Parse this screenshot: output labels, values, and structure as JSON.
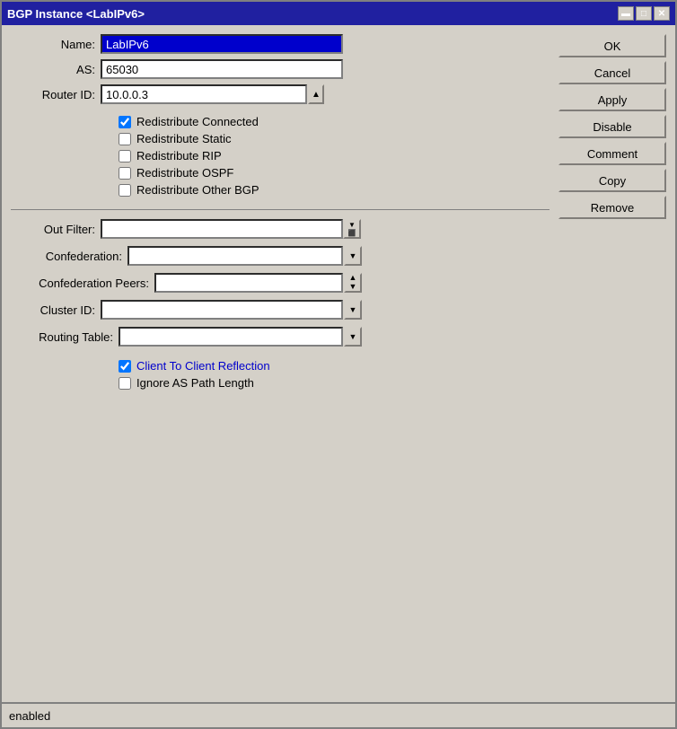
{
  "window": {
    "title": "BGP Instance <LabIPv6>",
    "min_label": "▬",
    "max_label": "□",
    "close_label": "✕"
  },
  "form": {
    "name_label": "Name:",
    "name_value": "LabIPv6",
    "as_label": "AS:",
    "as_value": "65030",
    "router_id_label": "Router ID:",
    "router_id_value": "10.0.0.3",
    "spin_up": "▲",
    "checkboxes": [
      {
        "label": "Redistribute Connected",
        "checked": true
      },
      {
        "label": "Redistribute Static",
        "checked": false
      },
      {
        "label": "Redistribute RIP",
        "checked": false
      },
      {
        "label": "Redistribute OSPF",
        "checked": false
      },
      {
        "label": "Redistribute Other BGP",
        "checked": false
      }
    ],
    "out_filter_label": "Out Filter:",
    "out_filter_value": "",
    "confederation_label": "Confederation:",
    "confederation_value": "",
    "confederation_peers_label": "Confederation Peers:",
    "confederation_peers_value": "",
    "cluster_id_label": "Cluster ID:",
    "cluster_id_value": "",
    "routing_table_label": "Routing Table:",
    "routing_table_value": "",
    "bottom_checkboxes": [
      {
        "label": "Client To Client Reflection",
        "checked": true
      },
      {
        "label": "Ignore AS Path Length",
        "checked": false
      }
    ],
    "dropdown_arrow": "▼",
    "filter_arrows": "▼",
    "spin_arrows": "⇅"
  },
  "buttons": {
    "ok": "OK",
    "cancel": "Cancel",
    "apply": "Apply",
    "disable": "Disable",
    "comment": "Comment",
    "copy": "Copy",
    "remove": "Remove"
  },
  "status": {
    "text": "enabled"
  }
}
